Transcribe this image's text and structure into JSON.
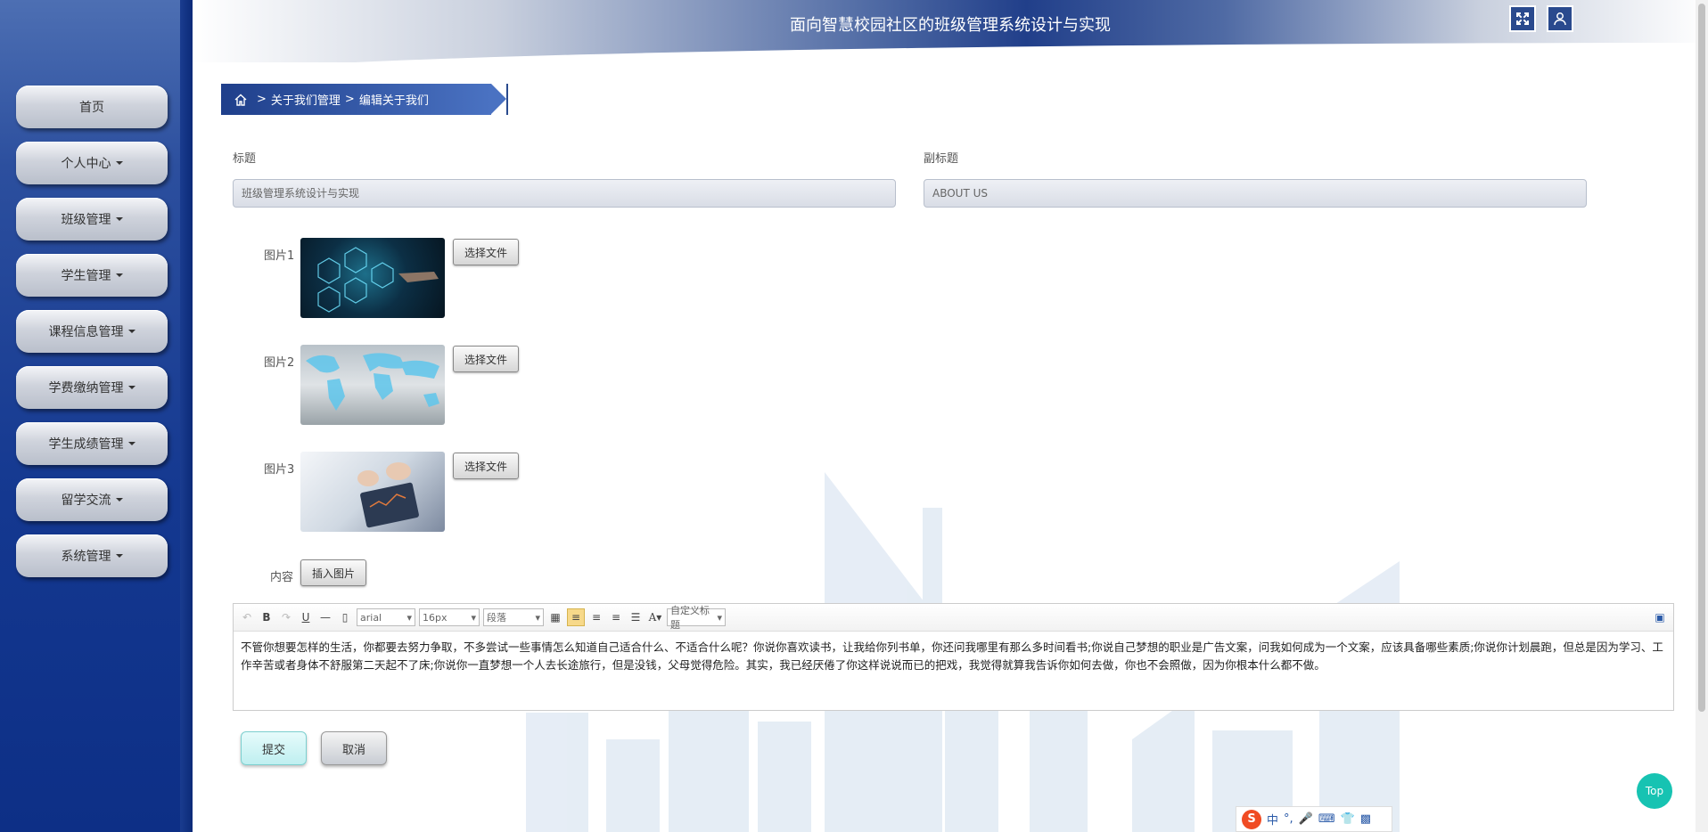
{
  "header": {
    "title": "面向智慧校园社区的班级管理系统设计与实现",
    "fullscreen_icon": "fullscreen-icon",
    "user_icon": "user-icon"
  },
  "sidebar": {
    "items": [
      {
        "label": "首页",
        "has_dropdown": false
      },
      {
        "label": "个人中心",
        "has_dropdown": true
      },
      {
        "label": "班级管理",
        "has_dropdown": true
      },
      {
        "label": "学生管理",
        "has_dropdown": true
      },
      {
        "label": "课程信息管理",
        "has_dropdown": true
      },
      {
        "label": "学费缴纳管理",
        "has_dropdown": true
      },
      {
        "label": "学生成绩管理",
        "has_dropdown": true
      },
      {
        "label": "留学交流",
        "has_dropdown": true
      },
      {
        "label": "系统管理",
        "has_dropdown": true
      }
    ]
  },
  "breadcrumb": {
    "home_icon": "home-icon",
    "items": [
      "关于我们管理",
      "编辑关于我们"
    ],
    "separator": ">"
  },
  "form": {
    "title_label": "标题",
    "title_value": "班级管理系统设计与实现",
    "subtitle_label": "副标题",
    "subtitle_value": "ABOUT US",
    "images": [
      {
        "label": "图片1",
        "button": "选择文件"
      },
      {
        "label": "图片2",
        "button": "选择文件"
      },
      {
        "label": "图片3",
        "button": "选择文件"
      }
    ],
    "content_label": "内容",
    "insert_image_button": "插入图片"
  },
  "editor": {
    "font_family": "arial",
    "font_size": "16px",
    "paragraph": "段落",
    "custom_heading": "自定义标题",
    "content": "不管你想要怎样的生活，你都要去努力争取，不多尝试一些事情怎么知道自己适合什么、不适合什么呢？你说你喜欢读书，让我给你列书单，你还问我哪里有那么多时间看书;你说自己梦想的职业是广告文案，问我如何成为一个文案，应该具备哪些素质;你说你计划晨跑，但总是因为学习、工作辛苦或者身体不舒服第二天起不了床;你说你一直梦想一个人去长途旅行，但是没钱，父母觉得危险。其实，我已经厌倦了你这样说说而已的把戏，我觉得就算我告诉你如何去做，你也不会照做，因为你根本什么都不做。"
  },
  "actions": {
    "submit": "提交",
    "cancel": "取消",
    "top": "Top"
  },
  "ime": {
    "mode": "中"
  },
  "colors": {
    "sidebar": "#143890",
    "breadcrumb": "#1f3f8b",
    "top_button": "#17c3b2",
    "submit": "#bfeff0"
  }
}
